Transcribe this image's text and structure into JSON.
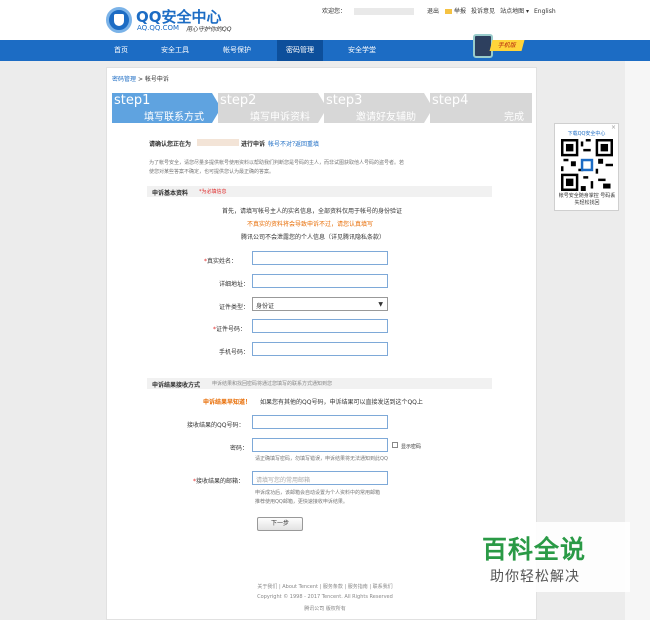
{
  "header": {
    "logo_title": "QQ安全中心",
    "logo_sub": "AQ.QQ.COM",
    "logo_slogan": "用心守护你的QQ",
    "welcome": "欢迎您：",
    "logout": "退出",
    "report": "举报",
    "feedback": "投诉意见",
    "sitemap": "站点地图 ▾",
    "english": "English"
  },
  "nav": {
    "items": [
      "首页",
      "安全工具",
      "帐号保护",
      "密码管理",
      "安全学堂"
    ],
    "active_index": 3,
    "phone_tag": "手机版"
  },
  "breadcrumb": {
    "parent": "密码管理",
    "sep": ">",
    "current": "帐号申诉"
  },
  "steps": [
    {
      "num": "step1",
      "name": "填写联系方式",
      "active": true
    },
    {
      "num": "step2",
      "name": "填写申诉资料",
      "active": false
    },
    {
      "num": "step3",
      "name": "邀请好友辅助",
      "active": false
    },
    {
      "num": "step4",
      "name": "完成",
      "active": false
    }
  ],
  "intro": {
    "line1_a": "请确认您正在为",
    "line1_b": "进行申诉",
    "line1_link1": "帐号不对？",
    "line1_link2": "返回重填",
    "line2": "为了帐号安全，请您尽量多提供帐号使用资料以帮助我们判断您是号码的主人，而非试图获取他人号码的盗号者。若",
    "line3": "使您对某些答案不确定，也可提供您认为最正确的答案。"
  },
  "basic": {
    "title": "申诉基本资料",
    "sub": "*为必填信息",
    "note1": "首先，请填写帐号主人的实名信息，全部资料仅用于帐号的身份验证",
    "note2": "不真实的资料将会导致申诉不过，请您认真填写",
    "note3": "腾讯公司不会泄露您的个人信息（详见腾讯隐私条款）",
    "fields": {
      "realname": "真实姓名：",
      "address": "详细地址：",
      "idtype": "证件类型：",
      "idtype_value": "身份证",
      "idnum": "证件号码：",
      "phone": "手机号码："
    }
  },
  "result": {
    "title": "申诉结果接收方式",
    "sub": "申诉结果和找回密码将通过您填写的联系方式通知到您",
    "hint_strong": "申诉结果早知道！",
    "hint": "如果您有其他的QQ号码，申诉结果可以直接发送到这个QQ上",
    "qq_label": "接收结果的QQ号码：",
    "pwd_label": "密码：",
    "show_pwd": "显示密码",
    "pwd_note": "请正确填写密码，勿填写错误，申诉结果将无法通知到此QQ",
    "email_label": "接收结果的邮箱：",
    "email_placeholder": "请填写您的常用邮箱",
    "email_note1": "申诉成功后，该邮箱会自动设置为个人资料中的常用邮箱",
    "email_note2": "推荐使用QQ邮箱，更快速接收申诉结果。",
    "next": "下一步"
  },
  "footer": {
    "links": "关于我们 | About Tencent | 服务条款 | 服务指南 | 联系我们",
    "copyright": "Copyright © 1998 - 2017 Tencent. All Rights Reserved",
    "company": "腾讯公司 版权所有"
  },
  "qr": {
    "title": "下载QQ安全中心",
    "close": "×",
    "caption": "帐号安全随身掌控 号码丢失轻松找回"
  },
  "watermark": {
    "main": "百科全说",
    "sub": "助你轻松解决"
  }
}
